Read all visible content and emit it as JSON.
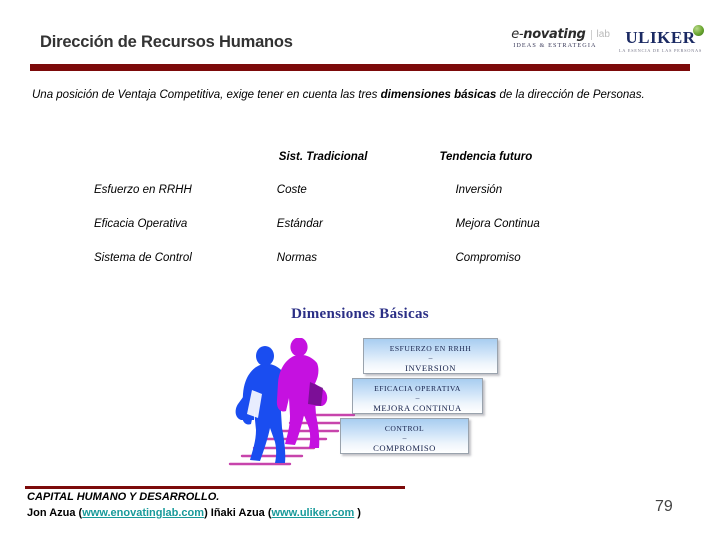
{
  "header": {
    "title": "Dirección de Recursos Humanos",
    "rule_color": "#7c0a0a",
    "logos": {
      "enovating": {
        "prefix": "e-",
        "name": "novating",
        "lab": "lab",
        "tagline": "IDEAS & ESTRATEGIA"
      },
      "uliker": {
        "name": "ULIKER",
        "tagline": "LA ESENCIA DE LAS PERSONAS"
      }
    }
  },
  "intro": {
    "part1": "Una posición de Ventaja Competitiva, exige tener en cuenta las tres ",
    "bold": "dimensiones básicas",
    "part2": " de la dirección de Personas."
  },
  "comparison": {
    "headers": [
      "",
      "Sist. Tradicional",
      "Tendencia futuro"
    ],
    "rows": [
      [
        "Esfuerzo en RRHH",
        "Coste",
        "Inversión"
      ],
      [
        "Eficacia Operativa",
        "Estándar",
        "Mejora Continua"
      ],
      [
        "Sistema de Control",
        "Normas",
        "Compromiso"
      ]
    ]
  },
  "diagram": {
    "title": "Dimensiones Básicas",
    "title_color": "#2b2f86",
    "boxes": [
      {
        "line1": "ESFUERZO EN RRHH",
        "dash": "–",
        "line2": "INVERSION"
      },
      {
        "line1": "EFICACIA OPERATIVA",
        "dash": "–",
        "line2": "MEJORA CONTINUA"
      },
      {
        "line1": "CONTROL",
        "dash": "–",
        "line2": "COMPROMISO"
      }
    ],
    "figure": {
      "person_front_color": "#c511e0",
      "person_back_color": "#1a4df0",
      "stairs_color": "#c53aa8"
    }
  },
  "footer": {
    "rule_color": "#7c0a0a",
    "line1": "CAPITAL HUMANO Y DESARROLLO.",
    "author1": "Jon Azua (",
    "link1": "www.enovatinglab.com",
    "mid": ") Iñaki Azua (",
    "link2": "www.uliker.com",
    "end": " )",
    "link_color": "#189a9a",
    "page_number": "79"
  }
}
